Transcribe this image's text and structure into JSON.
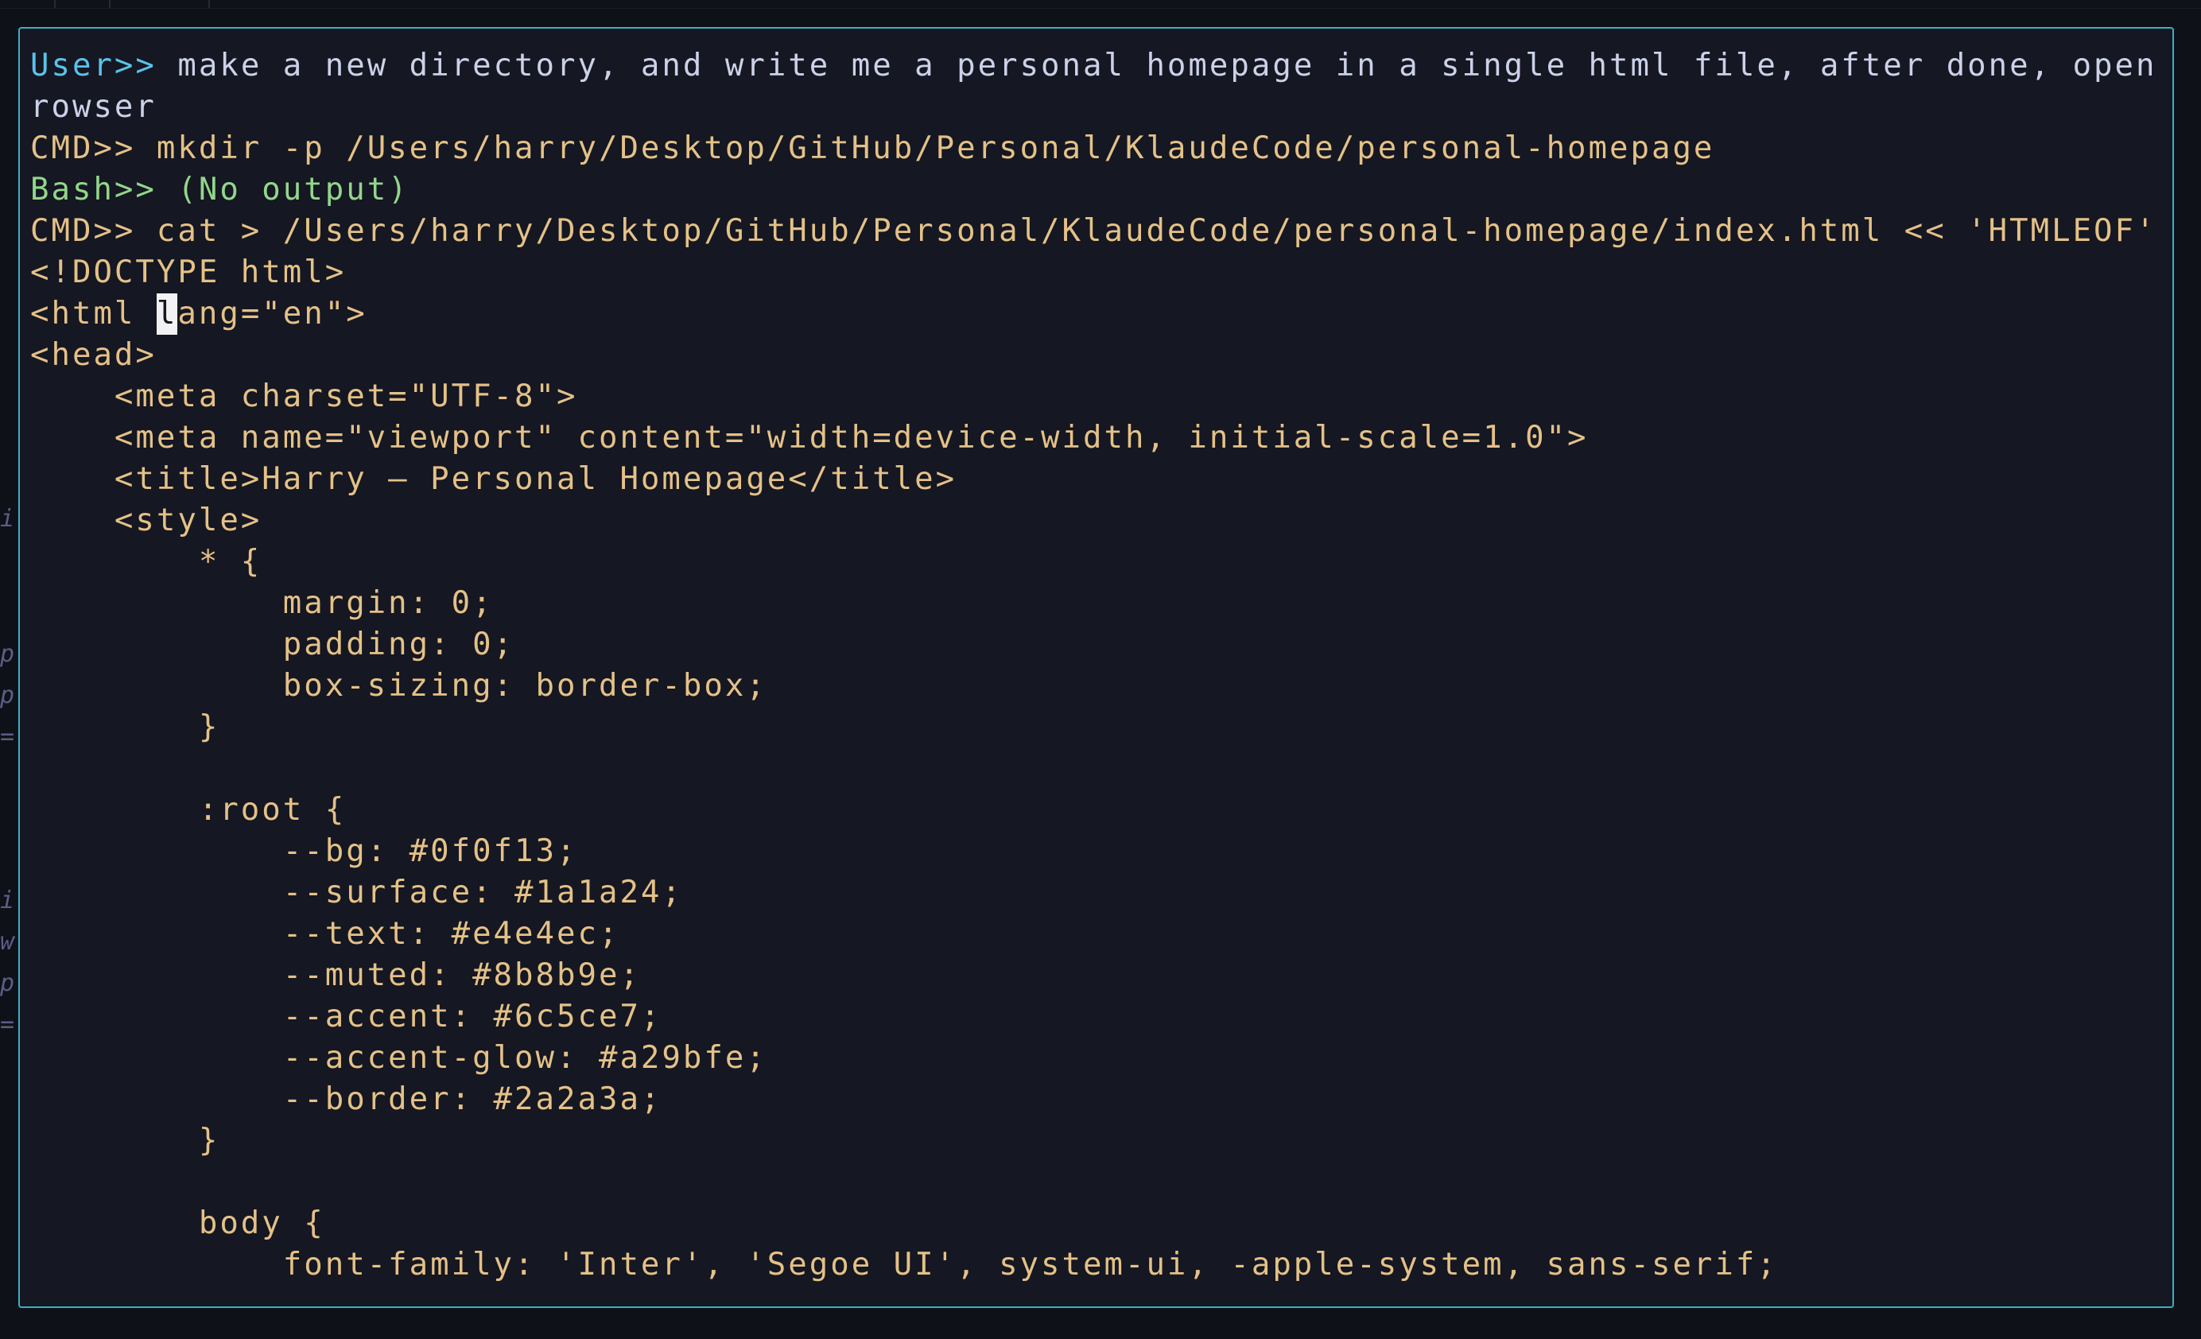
{
  "window": {
    "title": ""
  },
  "theme": {
    "background": "#0f1118",
    "pane_background": "#151722",
    "pane_border": "#3bb0c4",
    "user_prompt_color": "#59c3ea",
    "user_text_color": "#cbd1e8",
    "cmd_color": "#e4c187",
    "bash_color": "#93d68a",
    "cursor_color": "#f2f2f2"
  },
  "gutter": {
    "glyphs": [
      "i",
      "p",
      "p",
      "=",
      "i",
      "w",
      "p",
      "="
    ]
  },
  "terminal": {
    "cursor_line": 6,
    "cursor_char": "l",
    "lines": [
      {
        "type": "user",
        "prompt": "User>> ",
        "text": "make a new directory, and write me a personal homepage in a single html file, after done, open it in my b"
      },
      {
        "type": "user-wrap",
        "prompt": "",
        "text": "rowser"
      },
      {
        "type": "cmd",
        "prompt": "CMD>> ",
        "text": "mkdir -p /Users/harry/Desktop/GitHub/Personal/KlaudeCode/personal-homepage"
      },
      {
        "type": "bash",
        "prompt": "Bash>> ",
        "text": "(No output)"
      },
      {
        "type": "cmd",
        "prompt": "CMD>> ",
        "text": "cat > /Users/harry/Desktop/GitHub/Personal/KlaudeCode/personal-homepage/index.html << 'HTMLEOF'"
      },
      {
        "type": "code",
        "prompt": "",
        "text": "<!DOCTYPE html>"
      },
      {
        "type": "code",
        "prompt": "",
        "text": "<html ",
        "cursor": "l",
        "after": "ang=\"en\">"
      },
      {
        "type": "code",
        "prompt": "",
        "text": "<head>"
      },
      {
        "type": "code",
        "prompt": "",
        "text": "    <meta charset=\"UTF-8\">"
      },
      {
        "type": "code",
        "prompt": "",
        "text": "    <meta name=\"viewport\" content=\"width=device-width, initial-scale=1.0\">"
      },
      {
        "type": "code",
        "prompt": "",
        "text": "    <title>Harry — Personal Homepage</title>"
      },
      {
        "type": "code",
        "prompt": "",
        "text": "    <style>"
      },
      {
        "type": "code",
        "prompt": "",
        "text": "        * {"
      },
      {
        "type": "code",
        "prompt": "",
        "text": "            margin: 0;"
      },
      {
        "type": "code",
        "prompt": "",
        "text": "            padding: 0;"
      },
      {
        "type": "code",
        "prompt": "",
        "text": "            box-sizing: border-box;"
      },
      {
        "type": "code",
        "prompt": "",
        "text": "        }"
      },
      {
        "type": "code",
        "prompt": "",
        "text": ""
      },
      {
        "type": "code",
        "prompt": "",
        "text": "        :root {"
      },
      {
        "type": "code",
        "prompt": "",
        "text": "            --bg: #0f0f13;"
      },
      {
        "type": "code",
        "prompt": "",
        "text": "            --surface: #1a1a24;"
      },
      {
        "type": "code",
        "prompt": "",
        "text": "            --text: #e4e4ec;"
      },
      {
        "type": "code",
        "prompt": "",
        "text": "            --muted: #8b8b9e;"
      },
      {
        "type": "code",
        "prompt": "",
        "text": "            --accent: #6c5ce7;"
      },
      {
        "type": "code",
        "prompt": "",
        "text": "            --accent-glow: #a29bfe;"
      },
      {
        "type": "code",
        "prompt": "",
        "text": "            --border: #2a2a3a;"
      },
      {
        "type": "code",
        "prompt": "",
        "text": "        }"
      },
      {
        "type": "code",
        "prompt": "",
        "text": ""
      },
      {
        "type": "code",
        "prompt": "",
        "text": "        body {"
      },
      {
        "type": "code",
        "prompt": "",
        "text": "            font-family: 'Inter', 'Segoe UI', system-ui, -apple-system, sans-serif;"
      }
    ]
  }
}
